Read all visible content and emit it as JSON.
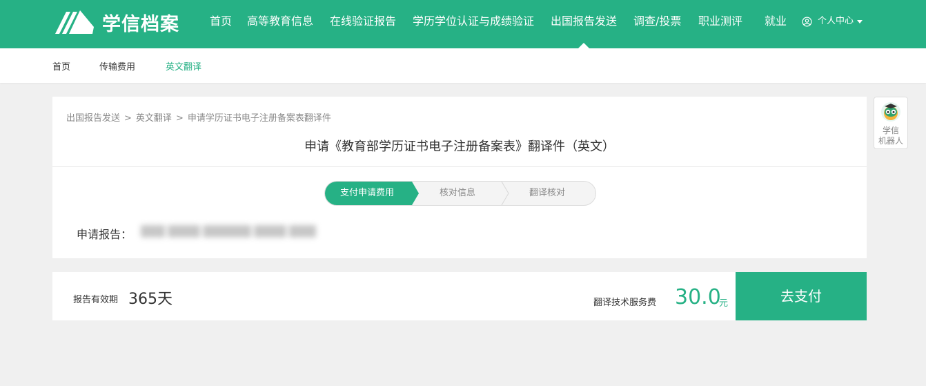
{
  "header": {
    "logo_text": "学信档案",
    "nav": [
      {
        "label": "首页"
      },
      {
        "label": "高等教育信息"
      },
      {
        "label": "在线验证报告"
      },
      {
        "label": "学历学位认证与成绩验证"
      },
      {
        "label": "出国报告发送"
      },
      {
        "label": "调查/投票"
      },
      {
        "label": "职业测评"
      },
      {
        "label": "就业"
      }
    ],
    "user_center": "个人中心"
  },
  "subnav": {
    "items": [
      {
        "label": "首页"
      },
      {
        "label": "传输费用"
      },
      {
        "label": "英文翻译"
      }
    ]
  },
  "breadcrumb": {
    "items": [
      "出国报告发送",
      "英文翻译",
      "申请学历证书电子注册备案表翻译件"
    ],
    "separator": ">"
  },
  "page": {
    "title": "申请《教育部学历证书电子注册备案表》翻译件（英文）"
  },
  "steps": [
    {
      "label": "支付申请费用"
    },
    {
      "label": "核对信息"
    },
    {
      "label": "翻译核对"
    }
  ],
  "application": {
    "label": "申请报告：",
    "value": "███ ████ ██████ ████ ████"
  },
  "payment": {
    "validity_label": "报告有效期",
    "validity_value": "365天",
    "fee_label": "翻译技术服务费",
    "fee_amount": "30.0",
    "fee_unit": "元",
    "pay_button": "去支付"
  },
  "robot": {
    "label": "学信\n机器人"
  },
  "colors": {
    "brand": "#26b185",
    "background": "#f0f0f0"
  }
}
